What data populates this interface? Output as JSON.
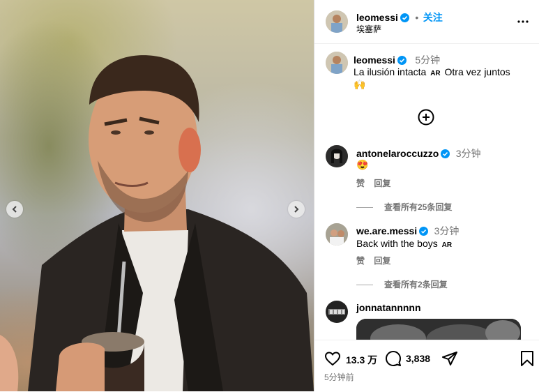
{
  "post": {
    "username": "leomessi",
    "follow_dot": "•",
    "follow_label": "关注",
    "location": "埃塞萨",
    "more_icon": "more-horizontal-icon"
  },
  "caption": {
    "username": "leomessi",
    "time": "5分钟",
    "text_line1": "La ilusión intacta",
    "flag1": "AR",
    "text_line1_tail": "Otra vez juntos",
    "emoji": "🙌"
  },
  "load_more_icon": "plus-circle-icon",
  "comments": [
    {
      "username": "antonelaroccuzzo",
      "time": "3分钟",
      "text": "😍",
      "like_label": "赞",
      "reply_label": "回复",
      "view_replies": "查看所有25条回复"
    },
    {
      "username": "we.are.messi",
      "time": "3分钟",
      "text": "Back with the boys",
      "flag": "AR",
      "like_label": "赞",
      "reply_label": "回复",
      "view_replies": "查看所有2条回复"
    },
    {
      "username": "jonnatannnnn"
    }
  ],
  "actions": {
    "likes": "13.3 万",
    "comments": "3,838",
    "posted": "5分钟前"
  },
  "colors": {
    "link_blue": "#0095f6",
    "verified_blue": "#0095f6",
    "secondary_text": "#737373",
    "divider": "#dbdbdb"
  }
}
